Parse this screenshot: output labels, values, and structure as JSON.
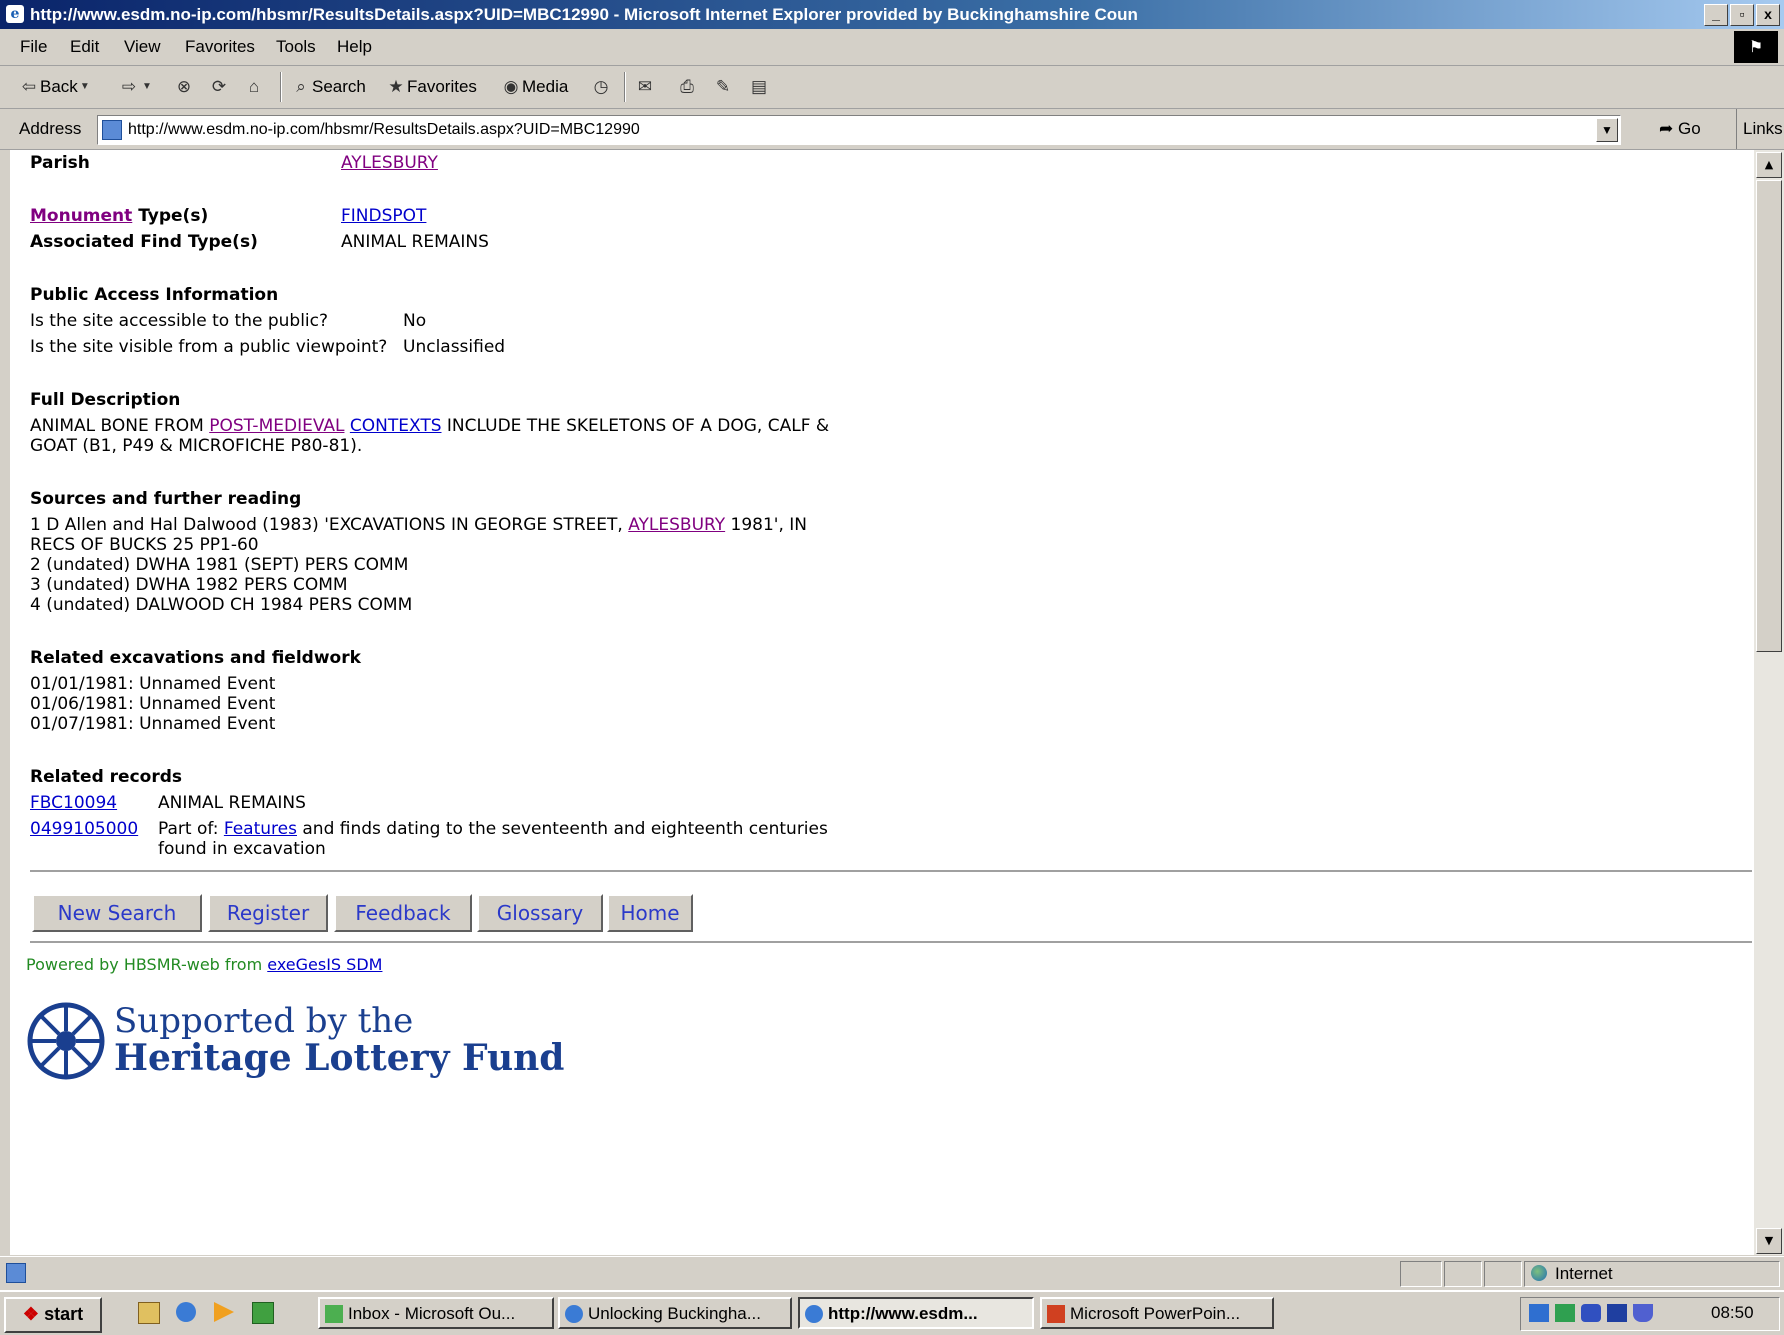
{
  "window": {
    "title": "http://www.esdm.no-ip.com/hbsmr/ResultsDetails.aspx?UID=MBC12990 - Microsoft Internet Explorer provided by Buckinghamshire Coun",
    "min_label": "_",
    "max_label": "▫",
    "close_label": "x"
  },
  "menu": [
    "File",
    "Edit",
    "View",
    "Favorites",
    "Tools",
    "Help"
  ],
  "toolbar": {
    "back": "Back",
    "search": "Search",
    "favorites": "Favorites",
    "media": "Media"
  },
  "address": {
    "label": "Address",
    "url": "http://www.esdm.no-ip.com/hbsmr/ResultsDetails.aspx?UID=MBC12990",
    "go": "Go",
    "links": "Links"
  },
  "record": {
    "parish_label": "Parish",
    "parish_value": "AYLESBURY",
    "monument_link": "Monument",
    "monument_label_rest": " Type(s)",
    "monument_value": "FINDSPOT",
    "assoc_label": "Associated Find Type(s)",
    "assoc_value": "ANIMAL REMAINS",
    "public_access_heading": "Public Access Information",
    "access_q": "Is the site accessible to the public?",
    "access_a": "No",
    "visible_q": "Is the site visible from a public viewpoint?",
    "visible_a": "Unclassified",
    "full_desc_heading": "Full Description",
    "desc_part1": "ANIMAL BONE FROM ",
    "desc_link1": "POST-MEDIEVAL",
    "desc_sp": " ",
    "desc_link2": "CONTEXTS",
    "desc_part2": " INCLUDE THE SKELETONS OF A DOG, CALF &",
    "desc_line2": "GOAT (B1, P49 & MICROFICHE P80-81).",
    "sources_heading": "Sources and further reading",
    "source1_part1": "1 D Allen and Hal Dalwood (1983) 'EXCAVATIONS IN GEORGE STREET, ",
    "source1_link": "AYLESBURY",
    "source1_part2": " 1981', IN",
    "source1_line2": "RECS OF BUCKS 25 PP1-60",
    "source2": "2 (undated) DWHA 1981 (SEPT) PERS COMM",
    "source3": "3 (undated) DWHA 1982 PERS COMM",
    "source4": "4 (undated) DALWOOD CH 1984 PERS COMM",
    "excav_heading": "Related excavations and fieldwork",
    "excav": [
      "01/01/1981: Unnamed Event",
      "01/06/1981: Unnamed Event",
      "01/07/1981: Unnamed Event"
    ],
    "related_heading": "Related records",
    "rel1_id": "FBC10094",
    "rel1_desc": "ANIMAL REMAINS",
    "rel2_id": "0499105000",
    "rel2_prefix": "Part of: ",
    "rel2_link": "Features",
    "rel2_rest": " and finds dating to the seventeenth and eighteenth centuries",
    "rel2_line2": "found in excavation"
  },
  "nav": [
    "New Search",
    "Register",
    "Feedback",
    "Glossary",
    "Home"
  ],
  "footer": {
    "powered_prefix": "Powered by HBSMR-web from ",
    "powered_link": "exeGesIS SDM",
    "hlf_line1": "Supported by the",
    "hlf_line2": "Heritage Lottery Fund"
  },
  "status": {
    "zone": "Internet"
  },
  "taskbar": {
    "start": "start",
    "tasks": [
      "Inbox - Microsoft Ou...",
      "Unlocking Buckingha...",
      "http://www.esdm...",
      "Microsoft PowerPoin..."
    ],
    "clock": "08:50"
  }
}
